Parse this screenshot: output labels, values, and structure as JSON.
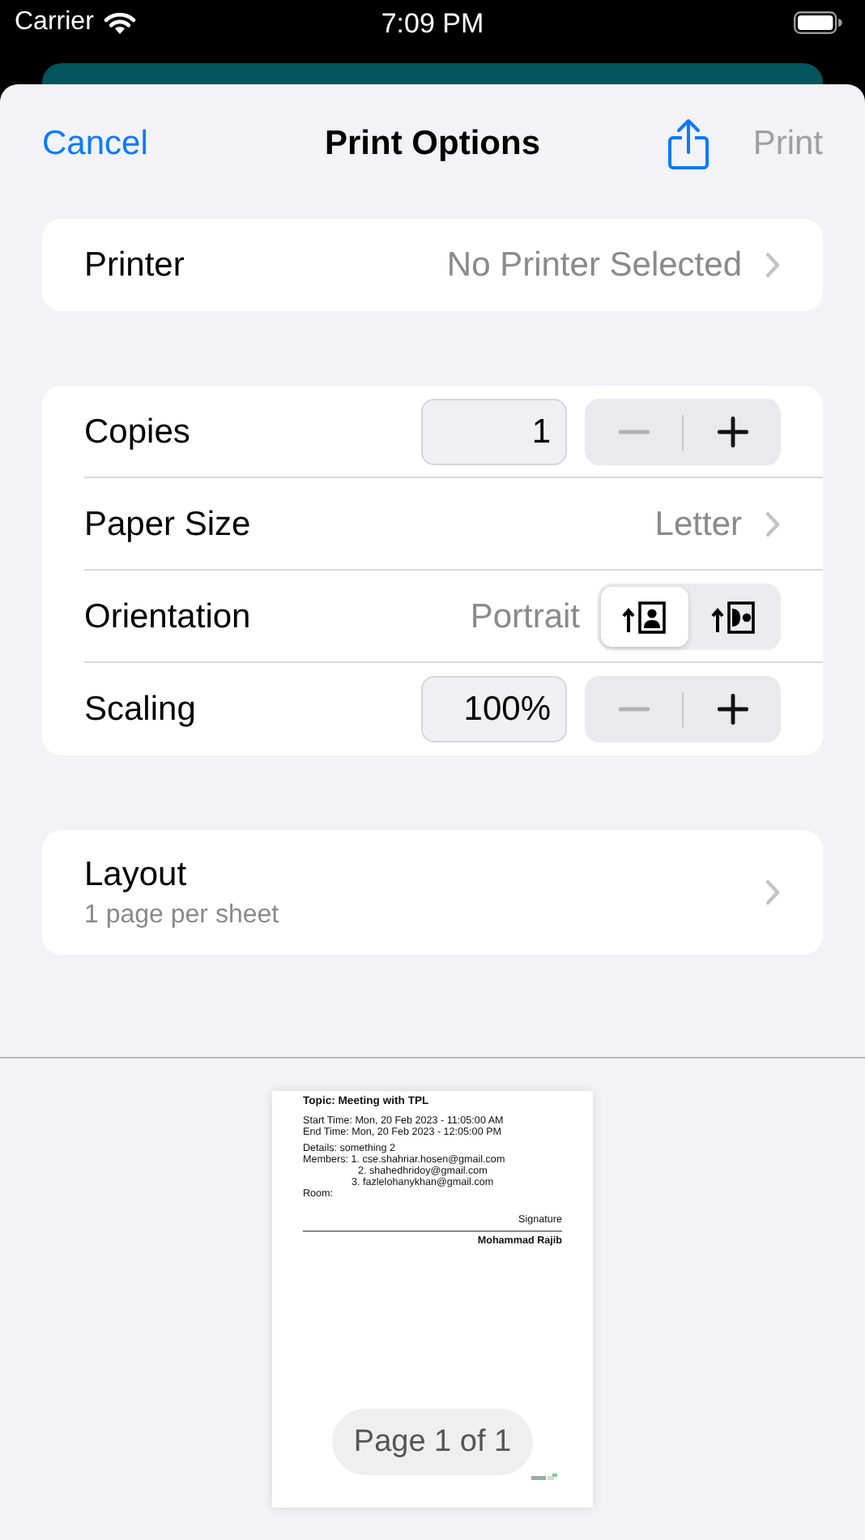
{
  "status_bar": {
    "carrier": "Carrier",
    "time": "7:09 PM"
  },
  "nav": {
    "cancel": "Cancel",
    "title": "Print Options",
    "print": "Print",
    "print_disabled": true
  },
  "printer": {
    "label": "Printer",
    "value": "No Printer Selected"
  },
  "options": [
    {
      "kind": "stepper",
      "label": "Copies",
      "value": "1"
    },
    {
      "kind": "disclosure",
      "label": "Paper Size",
      "value": "Letter"
    },
    {
      "kind": "orientation",
      "label": "Orientation",
      "value": "Portrait",
      "choices": [
        {
          "kind": "portrait",
          "selected": true
        },
        {
          "kind": "landscape",
          "selected": false
        }
      ]
    },
    {
      "kind": "stepper",
      "label": "Scaling",
      "value": "100%"
    }
  ],
  "layout": {
    "label": "Layout",
    "detail": "1 page per sheet"
  },
  "preview": {
    "topic": "Topic: Meeting with TPL",
    "times": [
      "Start Time: Mon, 20 Feb 2023 - 11:05:00 AM",
      "End Time: Mon, 20 Feb 2023 - 12:05:00 PM"
    ],
    "details": "Details: something 2",
    "members": [
      "Members: 1. cse.shahriar.hosen@gmail.com",
      "2. shahedhridoy@gmail.com",
      "3. fazlelohanykhan@gmail.com"
    ],
    "room": "Room:",
    "signature_label": "Signature",
    "signer": "Mohammad Rajib",
    "page_indicator": "Page 1 of 1"
  }
}
